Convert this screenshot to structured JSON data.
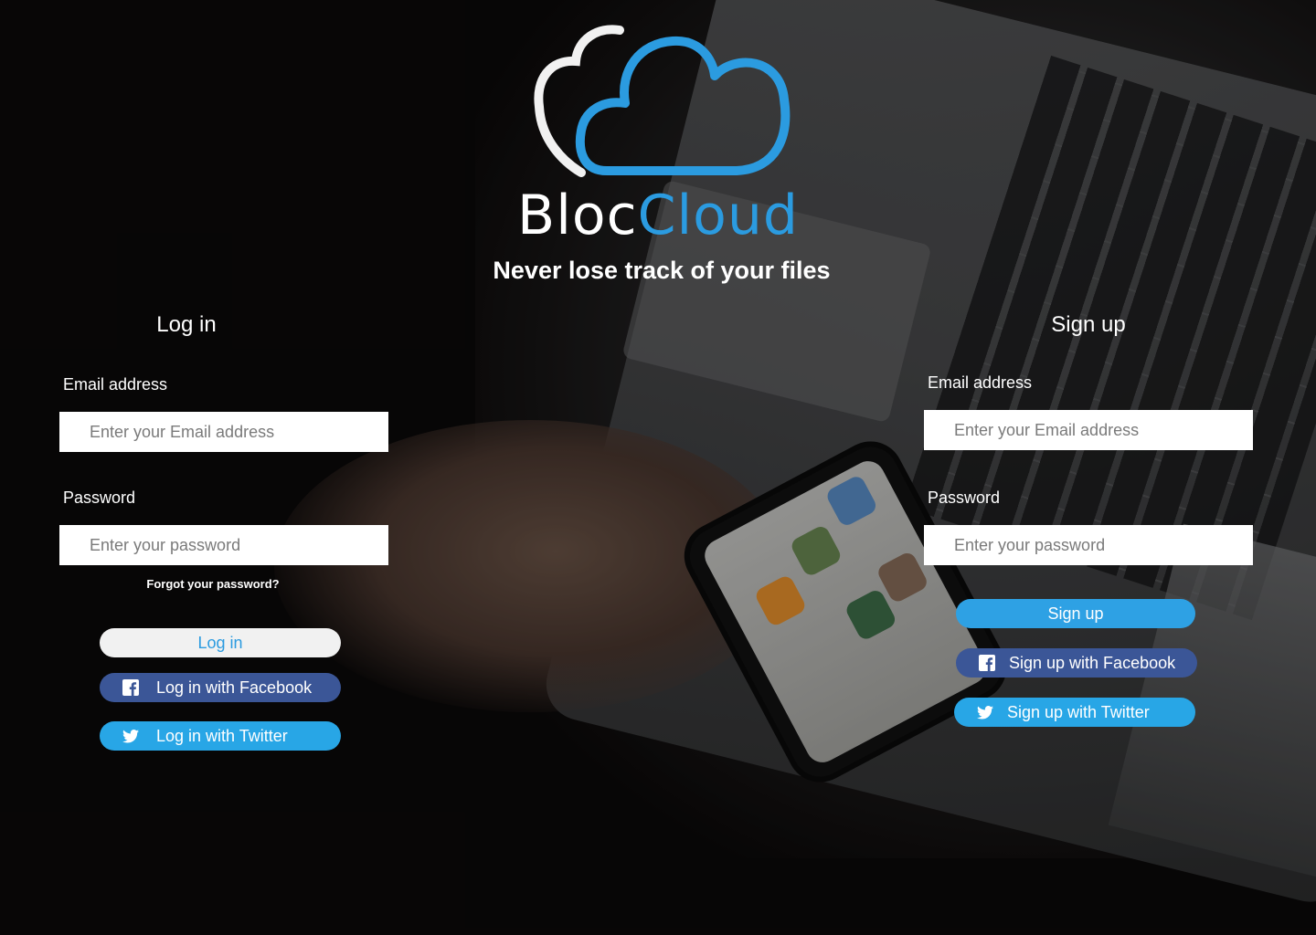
{
  "brand": {
    "name_part1": "Bloc",
    "name_part2": "Cloud",
    "tagline": "Never lose track of your files",
    "logo_icon": "cloud-icon",
    "accent_color": "#2b9be0"
  },
  "login": {
    "title": "Log in",
    "email_label": "Email address",
    "email_placeholder": "Enter your Email address",
    "password_label": "Password",
    "password_placeholder": "Enter your password",
    "forgot_link": "Forgot your password?",
    "submit_label": "Log in",
    "facebook_label": "Log in with Facebook",
    "twitter_label": "Log in with Twitter"
  },
  "signup": {
    "title": "Sign up",
    "email_label": "Email address",
    "email_placeholder": "Enter your Email address",
    "password_label": "Password",
    "password_placeholder": "Enter your password",
    "submit_label": "Sign up",
    "facebook_label": "Sign up with Facebook",
    "twitter_label": "Sign up with Twitter"
  },
  "colors": {
    "facebook": "#3b5697",
    "twitter": "#28a6e6",
    "primary_button": "#2ea1e4",
    "light_button": "#f1f1f1"
  },
  "icons": {
    "facebook": "facebook-icon",
    "twitter": "twitter-icon"
  }
}
